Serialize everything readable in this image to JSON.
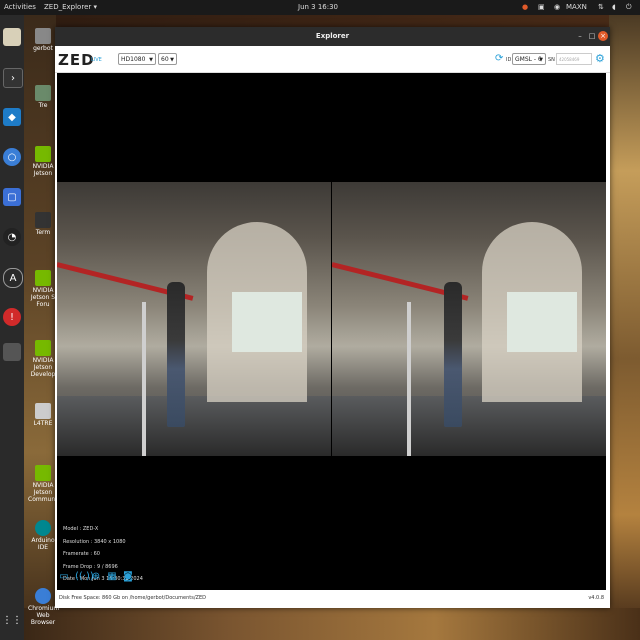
{
  "topbar": {
    "activities": "Activities",
    "app_menu": "ZED_Explorer ▾",
    "clock": "Jun 3 16:30",
    "keyboard": "MAXN",
    "power": "⏻"
  },
  "desktop_icons": [
    {
      "label": "gerbot"
    },
    {
      "label": "Tre"
    },
    {
      "label": "NVIDIA Jetson"
    },
    {
      "label": "Term"
    },
    {
      "label": "NVIDIA Jetson S Foru"
    },
    {
      "label": "NVIDIA Jetson Develop"
    },
    {
      "label": "L4TRE"
    },
    {
      "label": "NVIDIA Jetson Communit"
    },
    {
      "label": "Arduino IDE"
    },
    {
      "label": "Chromium Web Browser"
    }
  ],
  "window": {
    "title": "Explorer",
    "minimize": "–",
    "maximize": "□",
    "close": "×"
  },
  "toolbar": {
    "logo": "ZED",
    "live": "LIVE",
    "resolution": "HD1080",
    "fps": "60",
    "id_label": "ID",
    "id_value": "GMSL - 0",
    "sn_label": "SN",
    "sn_placeholder": "42058469"
  },
  "info": {
    "model": "Model : ZED-X",
    "resolution": "Resolution : 3840 x 1080",
    "framerate": "Framerate : 60",
    "frame_drop": "Frame Drop : 9 / 8696",
    "date": "Date : Mon Jun 3 16:30:32 2024"
  },
  "status": {
    "disk": "Disk Free Space: 860 Gb  on /home/gerbot/Documents/ZED",
    "version": "v4.0.8"
  },
  "colors": {
    "accent": "#2aa0d8",
    "close": "#e05a2a"
  },
  "icons": [
    "folder-icon",
    "stream-icon",
    "settings-icon",
    "video-icon",
    "camera-icon",
    "refresh-icon",
    "gear-icon"
  ]
}
